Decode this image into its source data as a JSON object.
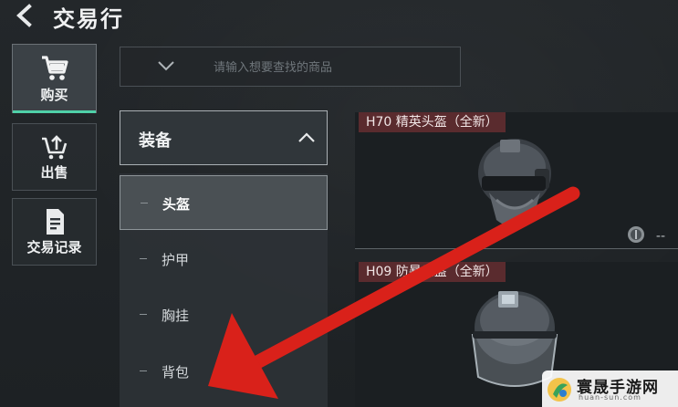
{
  "header": {
    "title": "交易行",
    "back_icon": "back-arrow-icon"
  },
  "nav": [
    {
      "label": "购买",
      "icon": "cart-icon",
      "active": true
    },
    {
      "label": "出售",
      "icon": "sell-cart-icon",
      "active": false
    },
    {
      "label": "交易记录",
      "icon": "document-icon",
      "active": false
    }
  ],
  "search": {
    "placeholder": "请输入想要查找的商品",
    "value": ""
  },
  "category": {
    "title": "装备",
    "expanded": true,
    "items": [
      {
        "label": "头盔",
        "active": true
      },
      {
        "label": "护甲",
        "active": false
      },
      {
        "label": "胸挂",
        "active": false
      },
      {
        "label": "背包",
        "active": false
      }
    ]
  },
  "products": [
    {
      "name": "H70 精英头盔（全新）",
      "price": "--",
      "price_icon": "coin-icon"
    },
    {
      "name": "H09 防暴头盔（全新）",
      "price": "",
      "price_icon": ""
    }
  ],
  "watermark": {
    "text": "寰晟手游网",
    "sub": "huan-sun.com"
  },
  "colors": {
    "accent": "#4fd0a8",
    "tag_bg": "#5a2b2e",
    "arrow": "#d9211a"
  }
}
